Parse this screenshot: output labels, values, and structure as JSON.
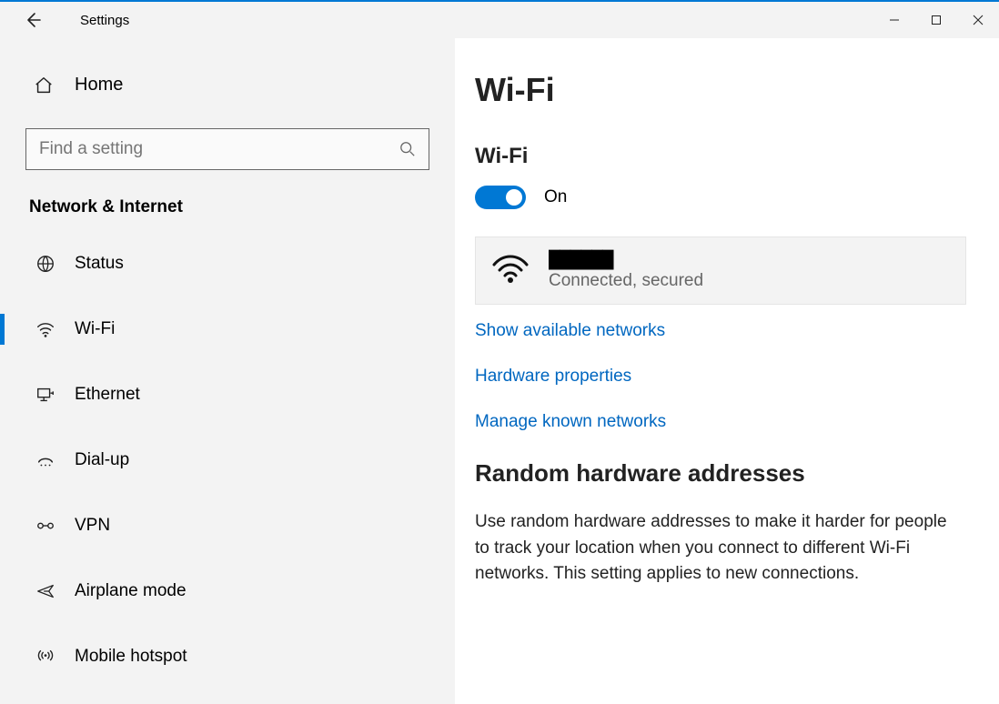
{
  "titlebar": {
    "title": "Settings"
  },
  "sidebar": {
    "home_label": "Home",
    "search_placeholder": "Find a setting",
    "section": "Network & Internet",
    "items": [
      {
        "label": "Status"
      },
      {
        "label": "Wi-Fi"
      },
      {
        "label": "Ethernet"
      },
      {
        "label": "Dial-up"
      },
      {
        "label": "VPN"
      },
      {
        "label": "Airplane mode"
      },
      {
        "label": "Mobile hotspot"
      }
    ]
  },
  "content": {
    "page_title": "Wi-Fi",
    "wifi_heading": "Wi-Fi",
    "toggle_state": "On",
    "network": {
      "name": "██████",
      "status": "Connected, secured"
    },
    "links": {
      "show_available": "Show available networks",
      "hardware_props": "Hardware properties",
      "manage_known": "Manage known networks"
    },
    "random_hw_title": "Random hardware addresses",
    "random_hw_body": "Use random hardware addresses to make it harder for people to track your location when you connect to different Wi-Fi networks. This setting applies to new connections."
  }
}
